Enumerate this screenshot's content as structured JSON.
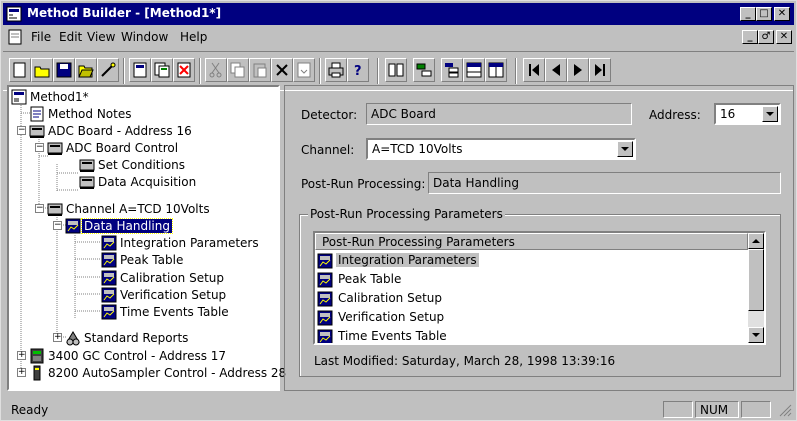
{
  "window": {
    "title": "Method Builder - [Method1*]",
    "caption_buttons": [
      "_",
      "□",
      "✕"
    ],
    "mdi_buttons": [
      "_",
      "♂",
      "✕"
    ]
  },
  "menu": [
    "File",
    "Edit",
    "View",
    "Window",
    "Help"
  ],
  "toolbar_icons": [
    "new-icon",
    "open-icon",
    "save-icon",
    "open-folder-icon",
    "wand-icon",
    "method-icon",
    "method-copy-icon",
    "delete-method-icon",
    "cut-icon",
    "copy-icon",
    "paste-icon",
    "delete-icon",
    "import-icon",
    "print-icon",
    "help-icon",
    "columns-icon",
    "tree-add-icon",
    "tree-icon",
    "rows-icon",
    "split-icon",
    "first-icon",
    "prev-icon",
    "next-icon",
    "last-icon"
  ],
  "tree": [
    {
      "label": "Method1*",
      "icon": "method-icon"
    },
    {
      "label": "Method Notes",
      "icon": "notes-icon"
    },
    {
      "label": "ADC Board - Address 16",
      "icon": "device-icon"
    },
    {
      "label": "ADC Board Control",
      "icon": "device-icon"
    },
    {
      "label": "Set Conditions",
      "icon": "device-icon"
    },
    {
      "label": "Data Acquisition",
      "icon": "device-icon"
    },
    {
      "label": "Channel A=TCD 10Volts",
      "icon": "device-icon"
    },
    {
      "label": "Data Handling",
      "icon": "data-handling-icon"
    },
    {
      "label": "Integration Parameters",
      "icon": "data-handling-icon"
    },
    {
      "label": "Peak Table",
      "icon": "data-handling-icon"
    },
    {
      "label": "Calibration Setup",
      "icon": "data-handling-icon"
    },
    {
      "label": "Verification Setup",
      "icon": "data-handling-icon"
    },
    {
      "label": "Time Events Table",
      "icon": "data-handling-icon"
    },
    {
      "label": "Standard Reports",
      "icon": "reports-icon"
    },
    {
      "label": "3400 GC Control - Address 17",
      "icon": "gc-icon"
    },
    {
      "label": "8200 AutoSampler Control - Address 28",
      "icon": "autosampler-icon"
    }
  ],
  "detail": {
    "detector_label": "Detector:",
    "detector_value": "ADC Board",
    "address_label": "Address:",
    "address_value": "16",
    "channel_label": "Channel:",
    "channel_value": "A=TCD 10Volts",
    "postrun_label": "Post-Run Processing:",
    "postrun_value": "Data Handling",
    "group_title": "Post-Run Processing Parameters",
    "list_header": "Post-Run Processing Parameters",
    "list_items": [
      "Integration Parameters",
      "Peak Table",
      "Calibration Setup",
      "Verification Setup",
      "Time Events Table"
    ],
    "last_modified": "Last Modified:  Saturday, March 28, 1998 13:39:16"
  },
  "status": {
    "text": "Ready",
    "num": "NUM"
  },
  "colors": {
    "titlebar": "#000080",
    "face": "#c0c0c0",
    "selection": "#000080"
  }
}
